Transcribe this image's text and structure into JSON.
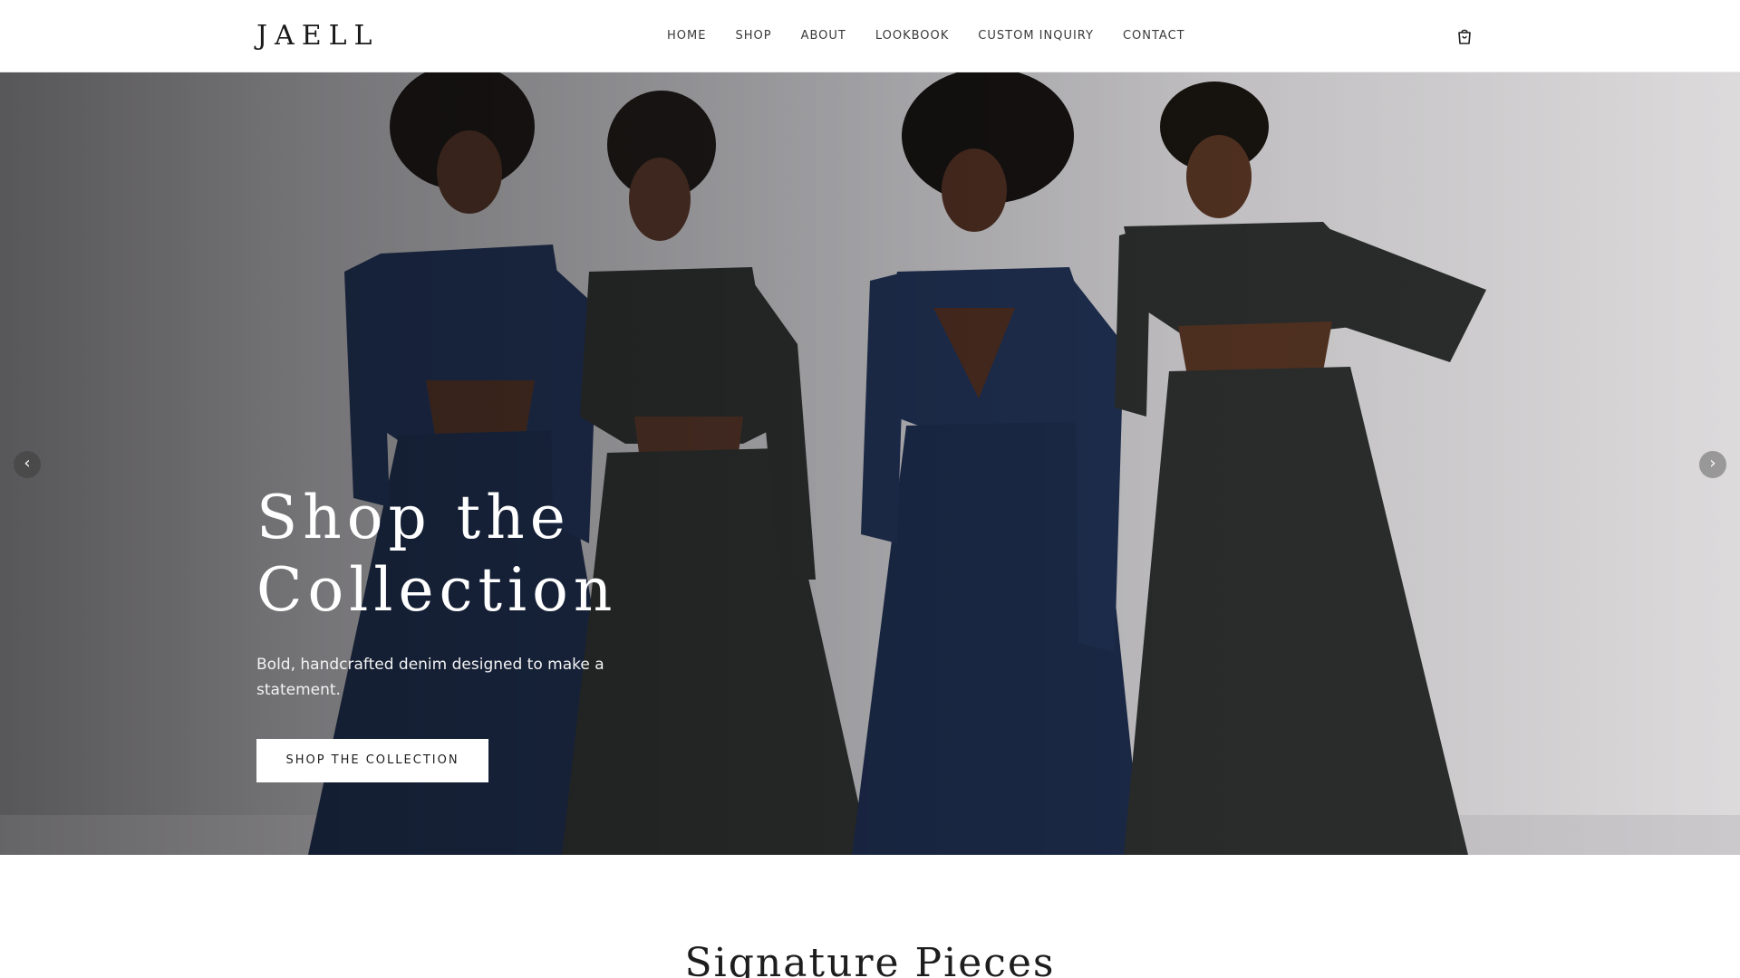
{
  "brand": {
    "logo": "JAELL"
  },
  "nav": {
    "items": [
      {
        "label": "HOME"
      },
      {
        "label": "SHOP"
      },
      {
        "label": "ABOUT"
      },
      {
        "label": "LOOKBOOK"
      },
      {
        "label": "CUSTOM INQUIRY"
      },
      {
        "label": "CONTACT"
      }
    ],
    "cart_icon": "shopping-bag-icon"
  },
  "hero": {
    "title": "Shop the Collection",
    "subtitle": "Bold, handcrafted denim designed to make a statement.",
    "cta_label": "SHOP THE COLLECTION",
    "prev_icon": "chevron-left-icon",
    "next_icon": "chevron-right-icon",
    "prev_glyph": "‹",
    "next_glyph": "›",
    "image_subject": "four models posing in matching denim cropped jackets and wide-leg pants",
    "colors": {
      "indigo_denim": "#1f2f4f",
      "charcoal_denim": "#2a2d2c",
      "backdrop": "#c4c3c6"
    }
  },
  "section": {
    "title": "Signature Pieces"
  }
}
